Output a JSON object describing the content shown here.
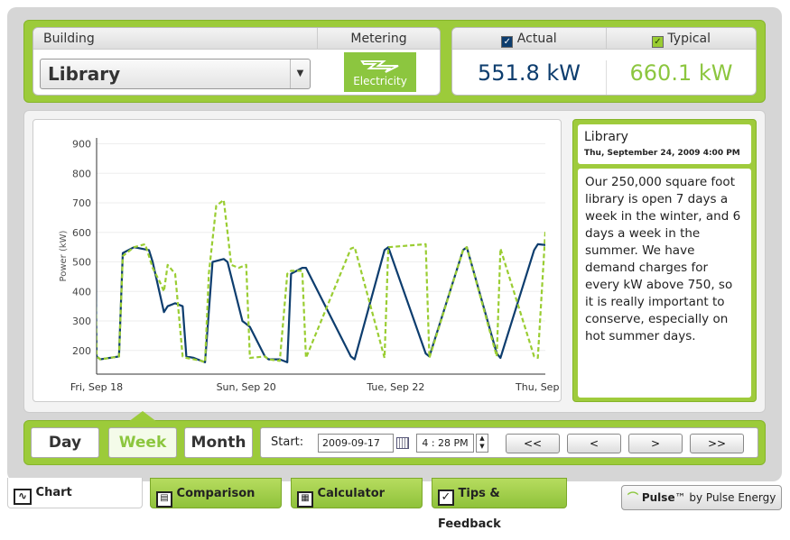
{
  "header": {
    "building_label": "Building",
    "building_value": "Library",
    "metering_label": "Metering",
    "metering_value": "Electricity",
    "actual_label": "Actual",
    "actual_value": "551.8 kW",
    "typical_label": "Typical",
    "typical_value": "660.1 kW"
  },
  "info": {
    "title": "Library",
    "date": "Thu, September 24, 2009 4:00 PM",
    "text": "Our 250,000 square foot library is open 7 days a week in the winter, and 6 days a week in the summer. We have demand charges for every kW above 750, so it is really important to conserve, especially on hot summer days."
  },
  "controls": {
    "day": "Day",
    "week": "Week",
    "month": "Month",
    "start_label": "Start:",
    "start_date": "2009-09-17",
    "start_time": "4 : 28 PM",
    "first": "<<",
    "prev": "<",
    "next": ">",
    "last": ">>"
  },
  "tabs": {
    "chart": "Chart",
    "comparison": "Comparison",
    "calculator": "Calculator",
    "tips": "Tips & Feedback"
  },
  "brand": {
    "name": "Pulse",
    "rest": "™ by Pulse Energy"
  },
  "colors": {
    "actual": "#0d3d6e",
    "typical": "#9acd32",
    "accent_green": "#9ccb3a"
  },
  "chart_data": {
    "type": "line",
    "ylabel": "Power (kW)",
    "yticks": [
      200,
      300,
      400,
      500,
      600,
      700,
      800,
      900
    ],
    "ylim": [
      120,
      920
    ],
    "xlim": [
      0,
      6.0
    ],
    "xtick_labels": [
      "Fri, Sep 18",
      "Sun, Sep 20",
      "Tue, Sep 22",
      "Thu, Sep 24"
    ],
    "xtick_pos": [
      0,
      2,
      4,
      6
    ],
    "series": [
      {
        "name": "Actual",
        "x": [
          -0.2,
          -0.12,
          -0.05,
          -0.02,
          0.0,
          0.05,
          0.3,
          0.35,
          0.5,
          0.7,
          0.75,
          0.9,
          0.95,
          1.05,
          1.15,
          1.2,
          1.3,
          1.35,
          1.4,
          1.45,
          1.55,
          1.7,
          1.75,
          1.95,
          2.0,
          2.05,
          2.25,
          2.3,
          2.45,
          2.55,
          2.6,
          2.75,
          2.8,
          3.4,
          3.45,
          3.85,
          3.9,
          4.4,
          4.45,
          4.9,
          4.95,
          5.35,
          5.4,
          5.85,
          5.9,
          6.3
        ],
        "y": [
          650,
          640,
          620,
          600,
          180,
          170,
          180,
          530,
          550,
          540,
          500,
          330,
          350,
          360,
          350,
          180,
          175,
          170,
          165,
          160,
          500,
          510,
          500,
          300,
          290,
          280,
          180,
          170,
          170,
          160,
          460,
          480,
          480,
          180,
          170,
          540,
          550,
          190,
          180,
          540,
          550,
          190,
          175,
          540,
          560,
          550
        ]
      },
      {
        "name": "Typical",
        "x": [
          -0.2,
          -0.15,
          -0.05,
          -0.02,
          0.0,
          0.05,
          0.3,
          0.35,
          0.5,
          0.65,
          0.75,
          0.85,
          0.9,
          0.95,
          1.05,
          1.15,
          1.2,
          1.3,
          1.4,
          1.45,
          1.5,
          1.6,
          1.7,
          1.75,
          1.8,
          1.9,
          2.0,
          2.05,
          2.25,
          2.3,
          2.45,
          2.55,
          2.6,
          2.75,
          2.8,
          3.4,
          3.45,
          3.85,
          3.9,
          4.4,
          4.45,
          4.9,
          4.95,
          5.35,
          5.4,
          5.85,
          5.9,
          6.0,
          6.05,
          6.15,
          6.3
        ],
        "y": [
          530,
          430,
          470,
          480,
          180,
          170,
          180,
          520,
          550,
          560,
          480,
          430,
          400,
          490,
          460,
          180,
          175,
          170,
          165,
          160,
          460,
          690,
          710,
          600,
          490,
          480,
          490,
          175,
          180,
          170,
          165,
          460,
          470,
          470,
          175,
          545,
          550,
          175,
          550,
          560,
          175,
          540,
          550,
          180,
          545,
          180,
          175,
          600,
          640,
          610,
          660
        ]
      }
    ]
  }
}
